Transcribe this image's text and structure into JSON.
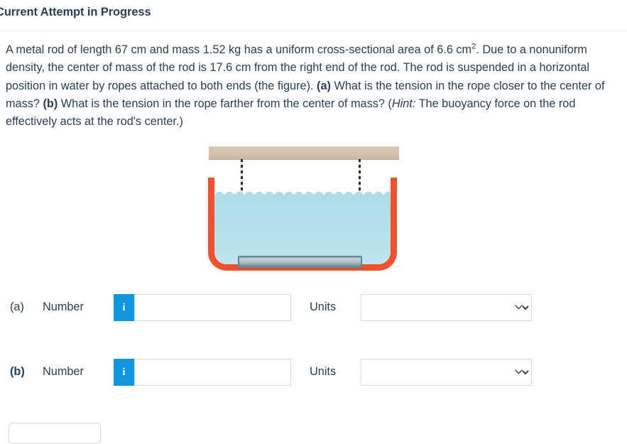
{
  "header": {
    "title": "Current Attempt in Progress"
  },
  "question": {
    "text_part_1": "A metal rod of length 67 cm and mass 1.52 kg has a uniform cross-sectional area of 6.6 cm",
    "superscript": "2",
    "text_part_2": ". Due to a nonuniform density, the center of mass of the rod is 17.6 cm from the right end of the rod. The rod is suspended in a horizontal position in water by ropes attached to both ends (the figure). ",
    "label_a": "(a)",
    "text_part_3": " What is the tension in the rope closer to the center of mass? ",
    "label_b": "(b)",
    "text_part_4": " What is the tension in the rope farther from the center of mass? (",
    "hint_label": "Hint:",
    "text_part_5": " The buoyancy force on the rod effectively acts at the rod's center.)"
  },
  "figure": {
    "description": "metal rod suspended by two ropes from a ceiling beam inside a water-filled container",
    "colors": {
      "beam": "#d3c1ab",
      "rope": "#2b2b28",
      "container": "#f2512d",
      "water": "#b4dfea",
      "rod": "#b0c1c6",
      "rod_border": "#5c8a99"
    }
  },
  "answers": [
    {
      "part": "(a)",
      "part_bold": false,
      "number_label": "Number",
      "info_icon": "i",
      "number_value": "",
      "number_placeholder": "",
      "units_label": "Units",
      "units_value": "",
      "units_options": [
        ""
      ]
    },
    {
      "part": "(b)",
      "part_bold": true,
      "number_label": "Number",
      "info_icon": "i",
      "number_value": "",
      "number_placeholder": "",
      "units_label": "Units",
      "units_value": "",
      "units_options": [
        ""
      ]
    }
  ],
  "bottom": {
    "partial_control": ""
  }
}
